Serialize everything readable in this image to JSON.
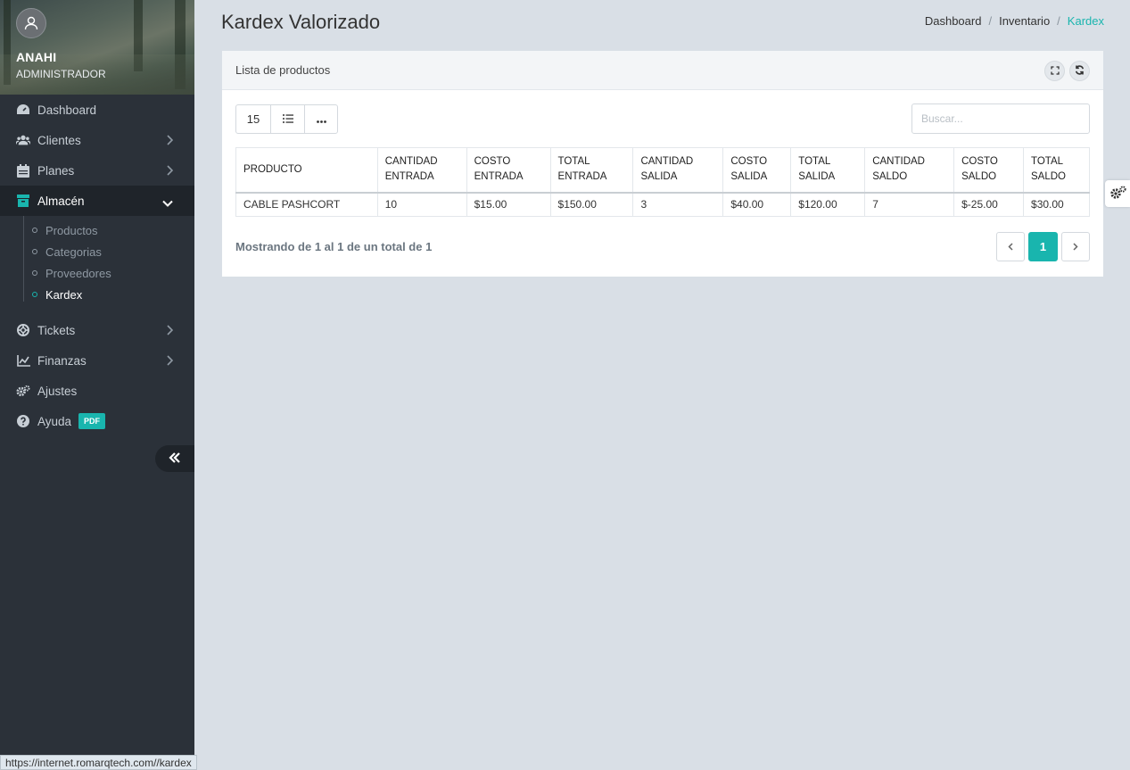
{
  "user": {
    "name": "ANAHI",
    "role": "ADMINISTRADOR"
  },
  "nav": {
    "dashboard": "Dashboard",
    "clientes": "Clientes",
    "planes": "Planes",
    "almacen": "Almacén",
    "sub": [
      "Productos",
      "Categorias",
      "Proveedores",
      "Kardex"
    ],
    "tickets": "Tickets",
    "finanzas": "Finanzas",
    "ajustes": "Ajustes",
    "ayuda": "Ayuda",
    "pdf_badge": "PDF"
  },
  "header": {
    "title": "Kardex Valorizado",
    "breadcrumb": [
      "Dashboard",
      "Inventario",
      "Kardex"
    ]
  },
  "card": {
    "title": "Lista de productos",
    "page_size": "15",
    "search_placeholder": "Buscar...",
    "columns": [
      [
        "PRODUCTO"
      ],
      [
        "CANTIDAD",
        "ENTRADA"
      ],
      [
        "COSTO",
        "ENTRADA"
      ],
      [
        "TOTAL",
        "ENTRADA"
      ],
      [
        "CANTIDAD",
        "SALIDA"
      ],
      [
        "COSTO",
        "SALIDA"
      ],
      [
        "TOTAL",
        "SALIDA"
      ],
      [
        "CANTIDAD",
        "SALDO"
      ],
      [
        "COSTO",
        "SALDO"
      ],
      [
        "TOTAL",
        "SALDO"
      ]
    ],
    "rows": [
      [
        "CABLE PASHCORT",
        "10",
        "$15.00",
        "$150.00",
        "3",
        "$40.00",
        "$120.00",
        "7",
        "$-25.00",
        "$30.00"
      ]
    ],
    "footer_info": "Mostrando de 1 al 1 de un total de 1",
    "current_page": "1"
  },
  "status_url": "https://internet.romarqtech.com//kardex",
  "colors": {
    "accent": "#19b5ae",
    "sidebar": "#2b3139",
    "background": "#d9dfe6"
  }
}
